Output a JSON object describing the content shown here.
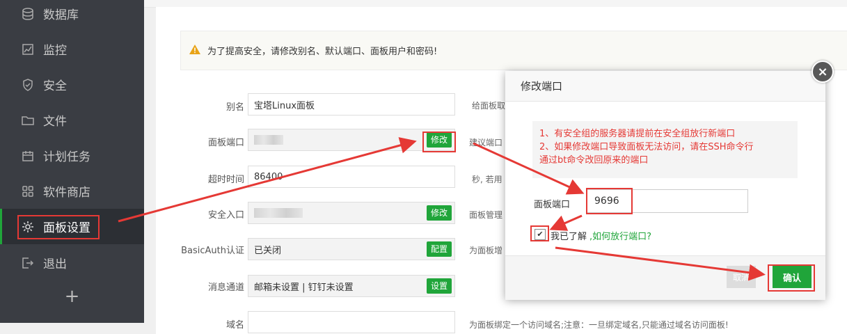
{
  "sidebar": {
    "items": [
      {
        "label": "数据库",
        "icon": "database-icon"
      },
      {
        "label": "监控",
        "icon": "monitor-icon"
      },
      {
        "label": "安全",
        "icon": "shield-icon"
      },
      {
        "label": "文件",
        "icon": "folder-icon"
      },
      {
        "label": "计划任务",
        "icon": "calendar-icon"
      },
      {
        "label": "软件商店",
        "icon": "grid-icon"
      },
      {
        "label": "面板设置",
        "icon": "gear-icon",
        "active": true
      },
      {
        "label": "退出",
        "icon": "logout-icon"
      }
    ],
    "add": "+"
  },
  "warning": "为了提高安全，请修改别名、默认端口、面板用户和密码!",
  "settings": {
    "alias": {
      "label": "别名",
      "value": "宝塔Linux面板",
      "hint": "给面板取"
    },
    "port": {
      "label": "面板端口",
      "button": "修改",
      "hint": "建议端口"
    },
    "timeout": {
      "label": "超时时间",
      "value": "86400",
      "hint": "秒, 若用"
    },
    "entry": {
      "label": "安全入口",
      "button": "修改",
      "hint": "面板管理"
    },
    "basic_auth": {
      "label": "BasicAuth认证",
      "value": "已关闭",
      "button": "配置",
      "hint": "为面板增"
    },
    "notify": {
      "label": "消息通道",
      "value": "邮箱未设置 | 钉钉未设置",
      "button": "设置"
    },
    "domain": {
      "label": "域名",
      "hint": "为面板绑定一个访问域名;注意：一旦绑定域名,只能通过域名访问面板!"
    }
  },
  "modal": {
    "title": "修改端口",
    "close": "×",
    "notice_line1": "1、有安全组的服务器请提前在安全组放行新端口",
    "notice_line2": "2、如果修改端口导致面板无法访问，请在SSH命令行",
    "notice_line3": "通过bt命令改回原来的端口",
    "port_label": "面板端口",
    "port_value": "9696",
    "checkbox_label": "我已了解",
    "checkbox_checked": true,
    "link": ",如何放行端口?",
    "cancel": "取消",
    "confirm": "确认"
  },
  "colors": {
    "accent": "#20a53a",
    "highlight": "#e53935",
    "sidebar_bg": "#3a3d43"
  }
}
